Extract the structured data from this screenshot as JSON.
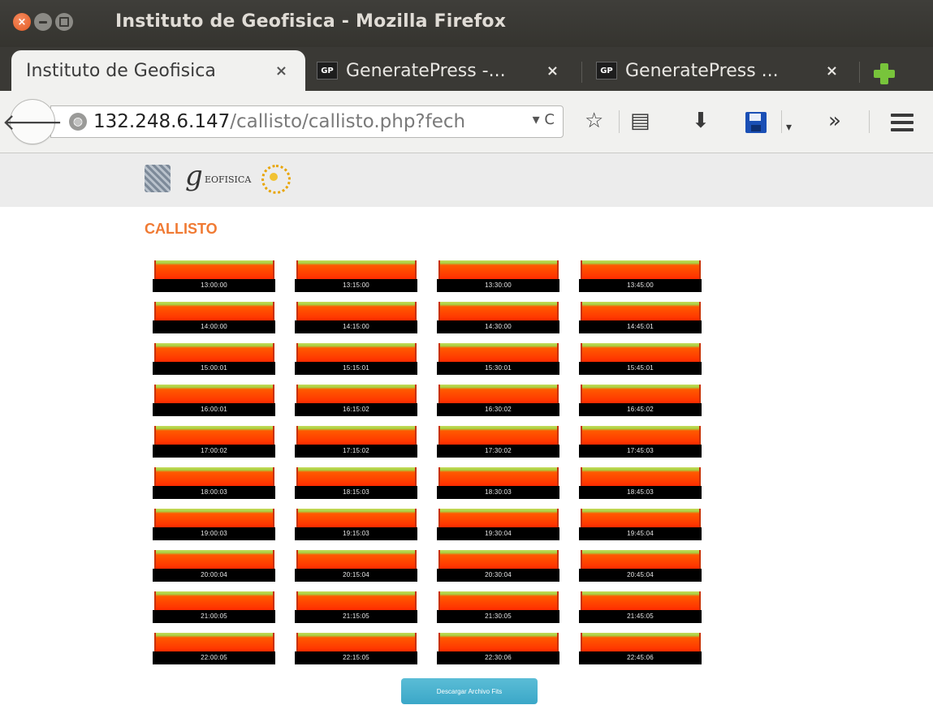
{
  "window": {
    "title": "Instituto de Geofisica - Mozilla Firefox"
  },
  "tabs": [
    {
      "label": "Instituto de Geofisica",
      "active": true,
      "favicon": ""
    },
    {
      "label": "GeneratePress -...",
      "active": false,
      "favicon": "GP"
    },
    {
      "label": "GeneratePress ...",
      "active": false,
      "favicon": "GP"
    }
  ],
  "tab_close_glyph": "×",
  "navbar": {
    "url_host": "132.248.6.147",
    "url_path": "/callisto/callisto.php?fech",
    "url_controls": "▾ C",
    "overflow": "»"
  },
  "page": {
    "logo_geo_text": "EOFISICA",
    "title": "CALLISTO",
    "download_button": "Descargar Archivo Fits"
  },
  "colors": {
    "title_orange": "#f07a33",
    "button_blue": "#3aa7c8",
    "spectrum_red": "#ff3a00",
    "spectrum_green": "#a6d243"
  },
  "spectrograms": [
    "13:00:00",
    "13:15:00",
    "13:30:00",
    "13:45:00",
    "14:00:00",
    "14:15:00",
    "14:30:00",
    "14:45:01",
    "15:00:01",
    "15:15:01",
    "15:30:01",
    "15:45:01",
    "16:00:01",
    "16:15:02",
    "16:30:02",
    "16:45:02",
    "17:00:02",
    "17:15:02",
    "17:30:02",
    "17:45:03",
    "18:00:03",
    "18:15:03",
    "18:30:03",
    "18:45:03",
    "19:00:03",
    "19:15:03",
    "19:30:04",
    "19:45:04",
    "20:00:04",
    "20:15:04",
    "20:30:04",
    "20:45:04",
    "21:00:05",
    "21:15:05",
    "21:30:05",
    "21:45:05",
    "22:00:05",
    "22:15:05",
    "22:30:06",
    "22:45:06"
  ]
}
